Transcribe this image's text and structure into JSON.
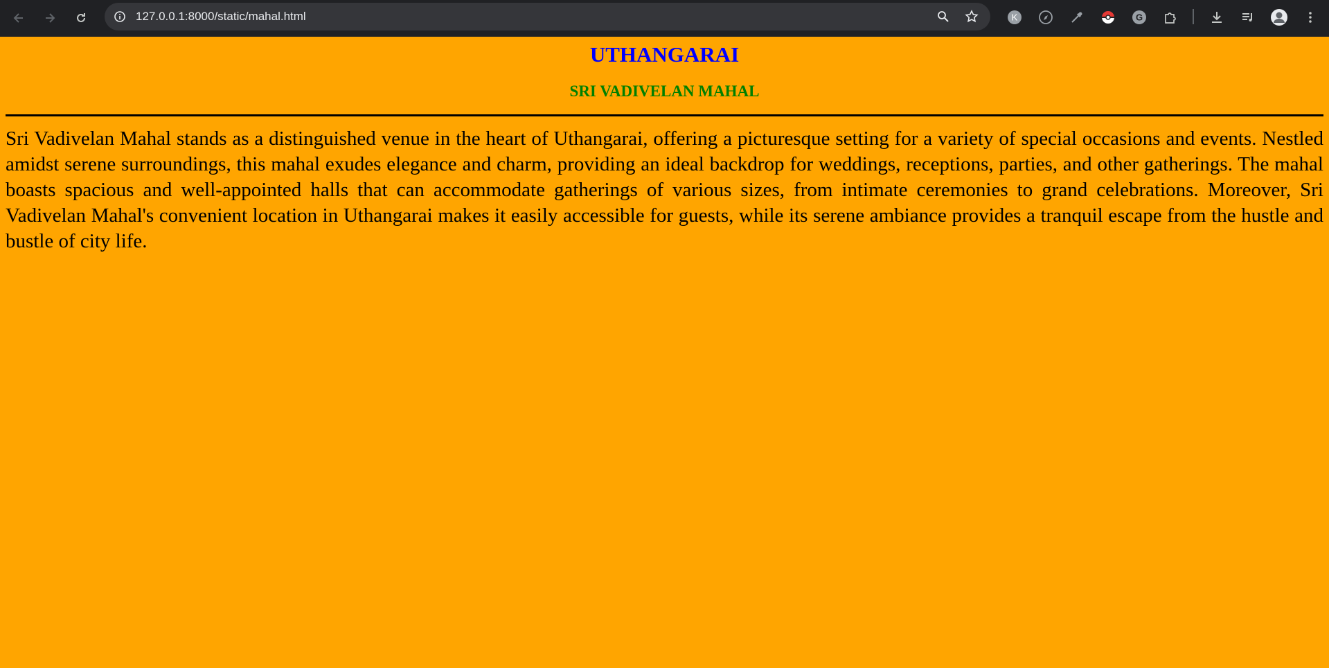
{
  "browser": {
    "url": "127.0.0.1:8000/static/mahal.html",
    "icons": {
      "back": "back-arrow-icon",
      "forward": "forward-arrow-icon",
      "reload": "reload-icon",
      "site_info": "site-info-icon",
      "zoom": "zoom-icon",
      "bookmark": "bookmark-star-icon",
      "download": "download-icon",
      "media": "media-control-icon",
      "menu": "more-menu-icon"
    },
    "extensions": [
      "k-extension-icon",
      "compass-extension-icon",
      "eyedropper-extension-icon",
      "pokeball-extension-icon",
      "grammarly-extension-icon",
      "puzzle-extensions-icon"
    ],
    "profile": "profile-avatar"
  },
  "page": {
    "title": "UTHANGARAI",
    "subtitle": "SRI VADIVELAN MAHAL",
    "paragraph": "Sri Vadivelan Mahal stands as a distinguished venue in the heart of Uthangarai, offering a picturesque setting for a variety of special occasions and events. Nestled amidst serene surroundings, this mahal exudes elegance and charm, providing an ideal backdrop for weddings, receptions, parties, and other gatherings. The mahal boasts spacious and well-appointed halls that can accommodate gatherings of various sizes, from intimate ceremonies to grand celebrations. Moreover, Sri Vadivelan Mahal's convenient location in Uthangarai makes it easily accessible for guests, while its serene ambiance provides a tranquil escape from the hustle and bustle of city life."
  },
  "colors": {
    "background": "#ffa500",
    "title": "#0000ff",
    "subtitle": "#008000",
    "text": "#000000",
    "browser_chrome": "#202124"
  }
}
